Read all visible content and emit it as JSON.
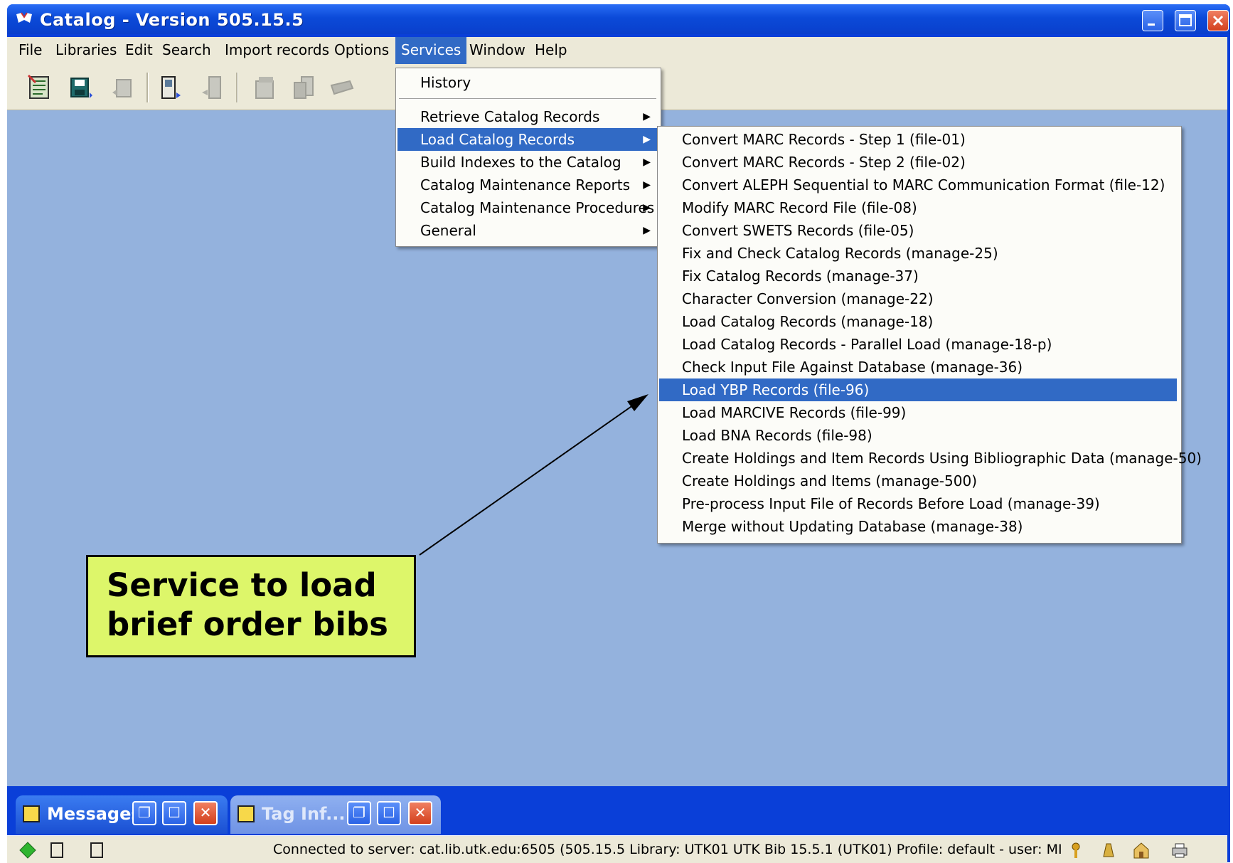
{
  "window": {
    "title": "Catalog - Version 505.15.5"
  },
  "menubar": {
    "items": [
      "File",
      "Libraries",
      "Edit",
      "Search",
      "Import records",
      "Options",
      "Services",
      "Window",
      "Help"
    ],
    "active": "Services"
  },
  "services_menu": {
    "history": "History",
    "items": [
      "Retrieve Catalog Records",
      "Load Catalog Records",
      "Build Indexes to the Catalog",
      "Catalog Maintenance Reports",
      "Catalog Maintenance Procedures",
      "General"
    ],
    "active": "Load Catalog Records"
  },
  "load_submenu": {
    "items": [
      "Convert MARC Records - Step 1 (file-01)",
      "Convert MARC Records - Step 2 (file-02)",
      "Convert ALEPH Sequential to MARC Communication Format (file-12)",
      "Modify MARC Record File (file-08)",
      "Convert SWETS Records (file-05)",
      "Fix and Check Catalog Records (manage-25)",
      "Fix Catalog Records (manage-37)",
      "Character Conversion (manage-22)",
      "Load Catalog Records (manage-18)",
      "Load Catalog Records - Parallel Load (manage-18-p)",
      "Check Input File Against Database (manage-36)",
      "Load YBP Records (file-96)",
      "Load MARCIVE Records (file-99)",
      "Load BNA Records (file-98)",
      "Create Holdings and Item Records Using Bibliographic Data (manage-50)",
      "Create Holdings and Items (manage-500)",
      "Pre-process Input File of Records Before Load (manage-39)",
      "Merge without Updating Database (manage-38)"
    ],
    "active": "Load YBP Records (file-96)"
  },
  "callout": {
    "line1": "Service to load",
    "line2": "brief order bibs",
    "background": "#ddf66a"
  },
  "taskbar": {
    "messages_label": "Messages",
    "taginfo_label": "Tag Inf..."
  },
  "statusbar": {
    "text": "Connected to server:  cat.lib.utk.edu:6505 (505.15.5  Library:  UTK01 UTK Bib 15.5.1 (UTK01)  Profile: default - user:  MI"
  },
  "colors": {
    "workspace": "#94b2dd",
    "highlight": "#316ac5",
    "chrome": "#ece9d8"
  }
}
